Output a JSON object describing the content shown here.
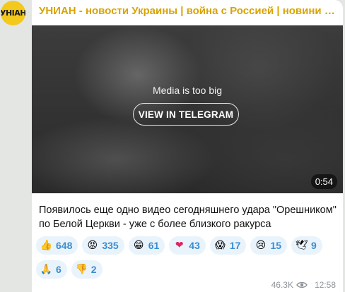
{
  "channel": {
    "title": "УНИАН - новости Украины | война с Россией | новини Украї...",
    "avatar_text": "УНІАН"
  },
  "media": {
    "note": "Media is too big",
    "button_label": "VIEW IN TELEGRAM",
    "duration": "0:54"
  },
  "message": {
    "caption": "Появилось еще одно видео сегодняшнего удара \"Орешником\" по Белой Церкви - уже с более близкого ракурса"
  },
  "reactions": [
    {
      "icon": "thumbs-up-icon",
      "glyph": "👍",
      "count": "648"
    },
    {
      "icon": "angry-face-icon",
      "glyph": "😡",
      "count": "335"
    },
    {
      "icon": "grinning-face-icon",
      "glyph": "😁",
      "count": "61"
    },
    {
      "icon": "heart-icon",
      "glyph": "❤",
      "count": "43"
    },
    {
      "icon": "screaming-face-icon",
      "glyph": "😱",
      "count": "17"
    },
    {
      "icon": "crying-face-icon",
      "glyph": "😢",
      "count": "15"
    },
    {
      "icon": "dove-icon",
      "glyph": "🕊",
      "count": "9"
    },
    {
      "icon": "praying-hands-icon",
      "glyph": "🙏",
      "count": "6"
    },
    {
      "icon": "thumbs-down-icon",
      "glyph": "👎",
      "count": "2"
    }
  ],
  "footer": {
    "views": "46.3K",
    "time": "12:58",
    "views_icon": "eye-icon"
  },
  "colors": {
    "title": "#d9a300",
    "reaction_bg": "#e9f3fb",
    "reaction_text": "#3a8dd1",
    "background": "#e4e6e3"
  }
}
